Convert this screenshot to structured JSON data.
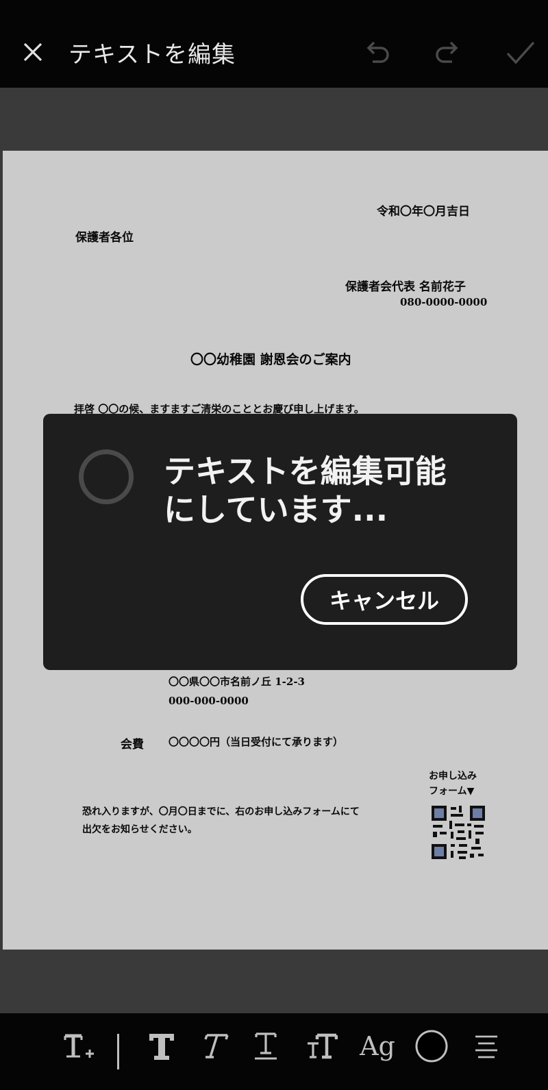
{
  "header": {
    "title": "テキストを編集"
  },
  "document": {
    "date": "令和〇年〇月吉日",
    "addressee": "保護者各位",
    "sender": "保護者会代表 名前花子",
    "phone": "080-0000-0000",
    "heading": "〇〇幼稚園 謝恩会のご案内",
    "greeting": "拝啓 〇〇の候、ますますご清栄のこととお慶び申し上げます。",
    "address": "〇〇県〇〇市名前ノ丘 1-2-3",
    "venue_phone": "000-000-0000",
    "fee_label": "会費",
    "fee_value": "〇〇〇〇円（当日受付にて承ります）",
    "form_label_line1": "お申し込み",
    "form_label_line2": "フォーム▼",
    "closing_line1": "恐れ入りますが、〇月〇日までに、右のお申し込みフォームにて",
    "closing_line2": "出欠をお知らせください。"
  },
  "dialog": {
    "message_line1": "テキストを編集可能",
    "message_line2": "にしています...",
    "cancel_label": "キャンセル"
  },
  "toolbar": {
    "add_text_icon": "T+",
    "bold_icon": "T",
    "italic_icon": "T",
    "underline_icon": "T",
    "size_icon": "tT",
    "font_icon": "Ag",
    "color_icon": "circle",
    "align_icon": "align-lines"
  },
  "colors": {
    "header_bg": "#050505",
    "canvas_bg": "#3a3a3a",
    "page_bg": "#cbcbcb",
    "dialog_bg": "#1e1e1e"
  }
}
